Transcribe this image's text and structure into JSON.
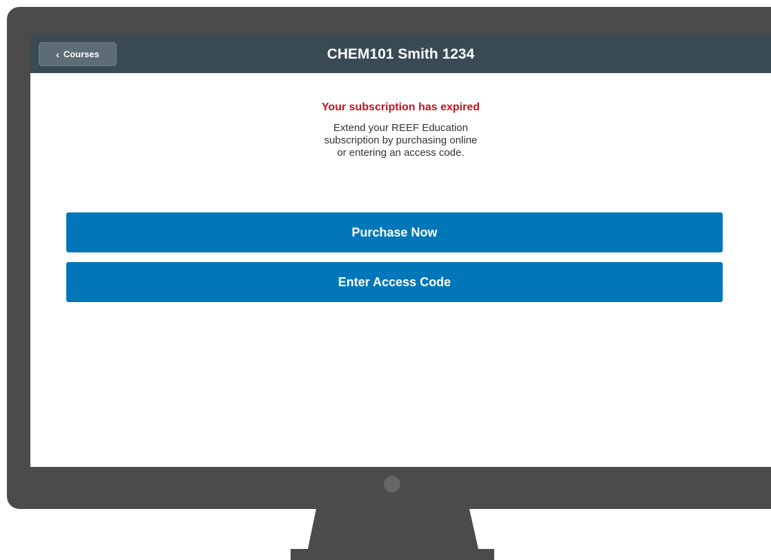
{
  "header": {
    "back_label": "Courses",
    "back_icon": "chevron-left-icon",
    "title": "CHEM101 Smith 1234"
  },
  "notice": {
    "title": "Your subscription has expired",
    "message_lines": [
      "Extend your REEF Education",
      "subscription by purchasing online",
      "or entering an access code."
    ]
  },
  "actions": {
    "purchase_label": "Purchase Now",
    "access_code_label": "Enter Access Code"
  },
  "colors": {
    "header_bg": "#394a55",
    "button_bg": "#0177b9",
    "alert_text": "#c0141b",
    "monitor_frame": "#4b4b4b"
  }
}
